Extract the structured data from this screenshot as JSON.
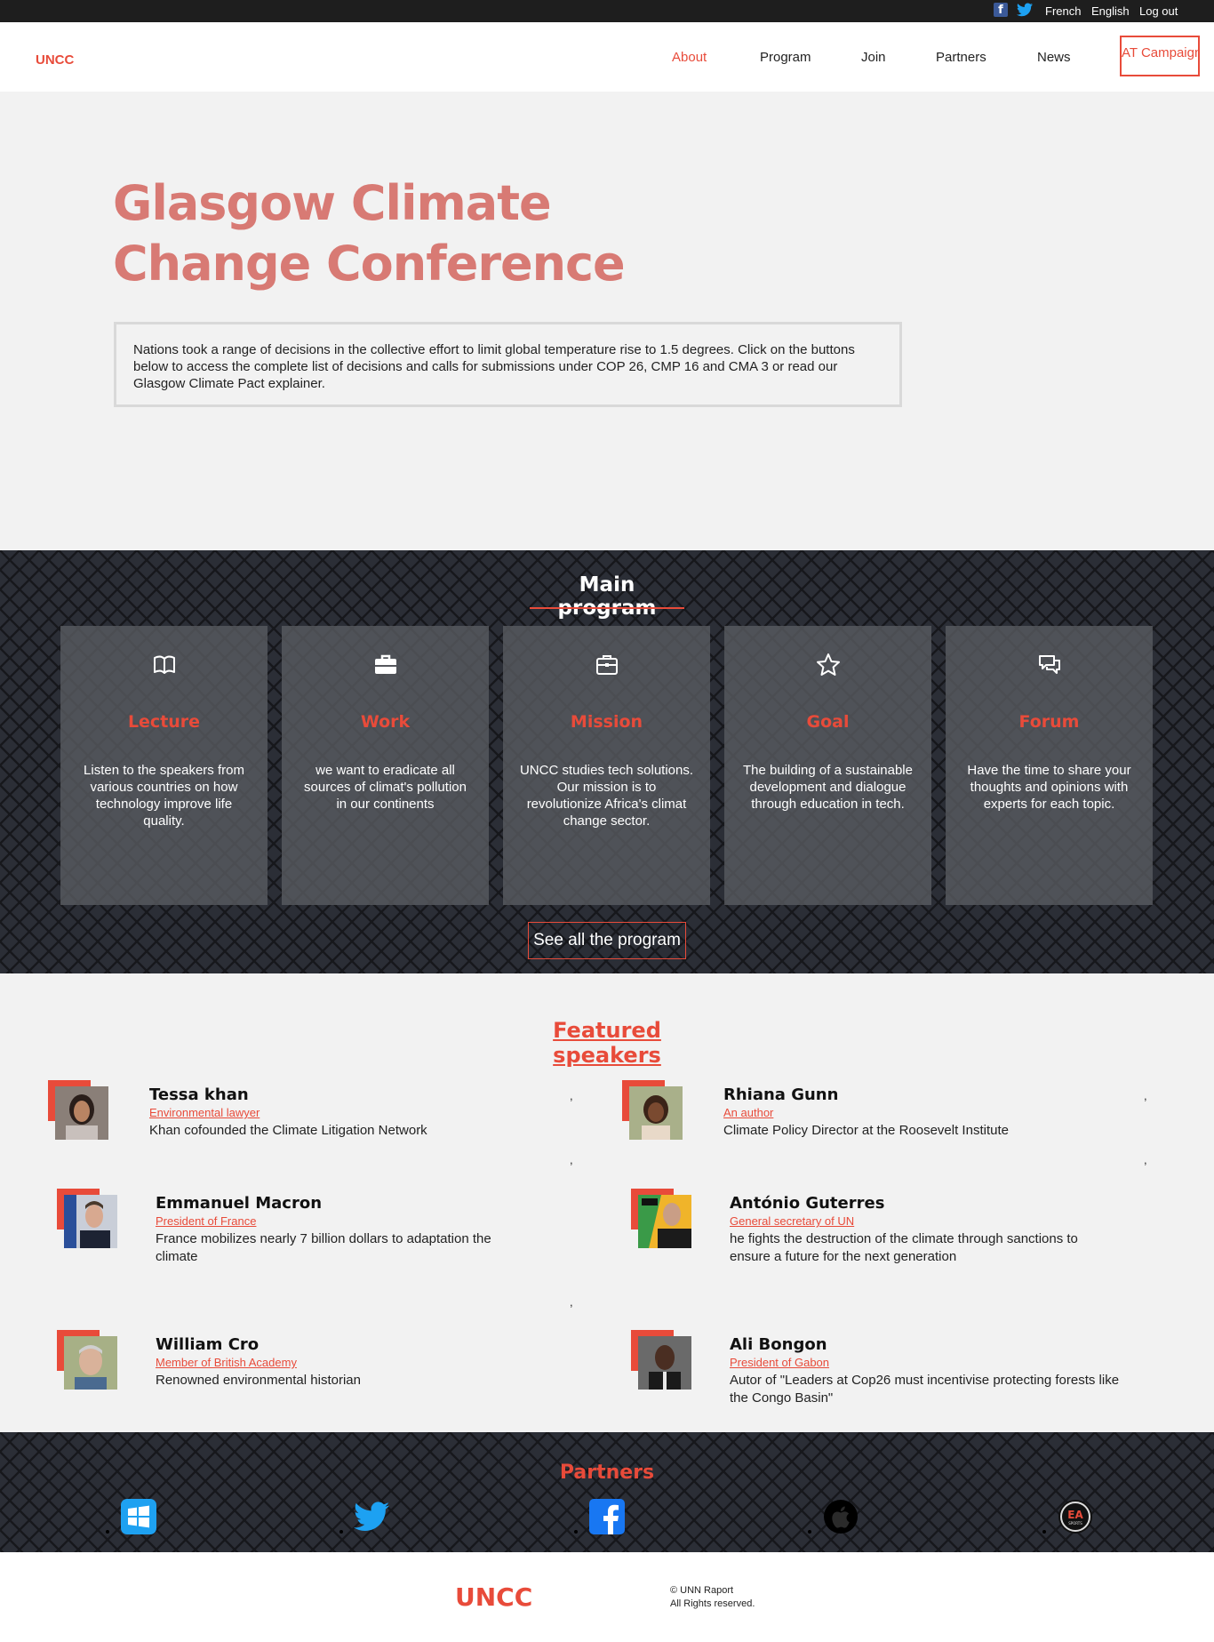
{
  "colors": {
    "accent": "#e84b3a",
    "dark": "#2b2e36",
    "topbar": "#1e1e1e"
  },
  "topbar": {
    "icons": [
      "facebook-icon",
      "twitter-icon"
    ],
    "links": [
      "French",
      "English",
      "Log out"
    ]
  },
  "header": {
    "logo": "UNCC",
    "nav": [
      "About",
      "Program",
      "Join",
      "Partners",
      "News"
    ],
    "active": "About",
    "cta": "AT Campaign"
  },
  "hero": {
    "title": "Glasgow Climate Change Conference",
    "text": "Nations took a range of decisions in the collective effort to limit global temperature rise to 1.5 degrees. Click on the buttons below to access the complete list of decisions and calls for submissions under COP 26, CMP 16 and CMA 3 or read our Glasgow Climate Pact explainer."
  },
  "program": {
    "title": "Main program",
    "cards": [
      {
        "icon": "book-icon",
        "title": "Lecture",
        "text": "Listen to the speakers from various countries on how technology improve life quality."
      },
      {
        "icon": "briefcase-filled-icon",
        "title": "Work",
        "text": "we want to eradicate all sources of climat's pollution in our continents"
      },
      {
        "icon": "briefcase-outline-icon",
        "title": "Mission",
        "text": "UNCC studies tech solutions. Our mission is to revolutionize Africa's climat change sector."
      },
      {
        "icon": "star-icon",
        "title": "Goal",
        "text": "The building of a sustainable development and dialogue through education in tech."
      },
      {
        "icon": "chat-icon",
        "title": "Forum",
        "text": "Have the time to share your thoughts and opinions with experts for each topic."
      }
    ],
    "button": "See all the program"
  },
  "speakers": {
    "title": "Featured speakers",
    "items": [
      {
        "name": "Tessa khan",
        "role": "Environmental lawyer",
        "desc": "Khan cofounded the Climate Litigation Network"
      },
      {
        "name": "Rhiana Gunn",
        "role": "An author",
        "desc": "Climate Policy Director at the Roosevelt Institute"
      },
      {
        "name": "Emmanuel Macron",
        "role": "President of France",
        "desc": "France mobilizes nearly 7 billion dollars to adaptation the climate"
      },
      {
        "name": "António Guterres",
        "role": "General secretary of UN",
        "desc": "he fights the destruction of the climate through sanctions to ensure a future for the next generation"
      },
      {
        "name": "William Cro",
        "role": "Member of British Academy",
        "desc": "Renowned environmental historian"
      },
      {
        "name": "Ali Bongon",
        "role": "President of Gabon",
        "desc": "Autor of \"Leaders at Cop26 must incentivise protecting forests like the Congo Basin\""
      }
    ],
    "separator": ","
  },
  "partners": {
    "title": "Partners",
    "logos": [
      "windows-icon",
      "twitter-bird-icon",
      "facebook-icon",
      "apple-icon",
      "ea-sports-icon"
    ]
  },
  "footer": {
    "logo": "UNCC",
    "copyright": "© UNN Raport",
    "rights": "All Rights reserved."
  }
}
